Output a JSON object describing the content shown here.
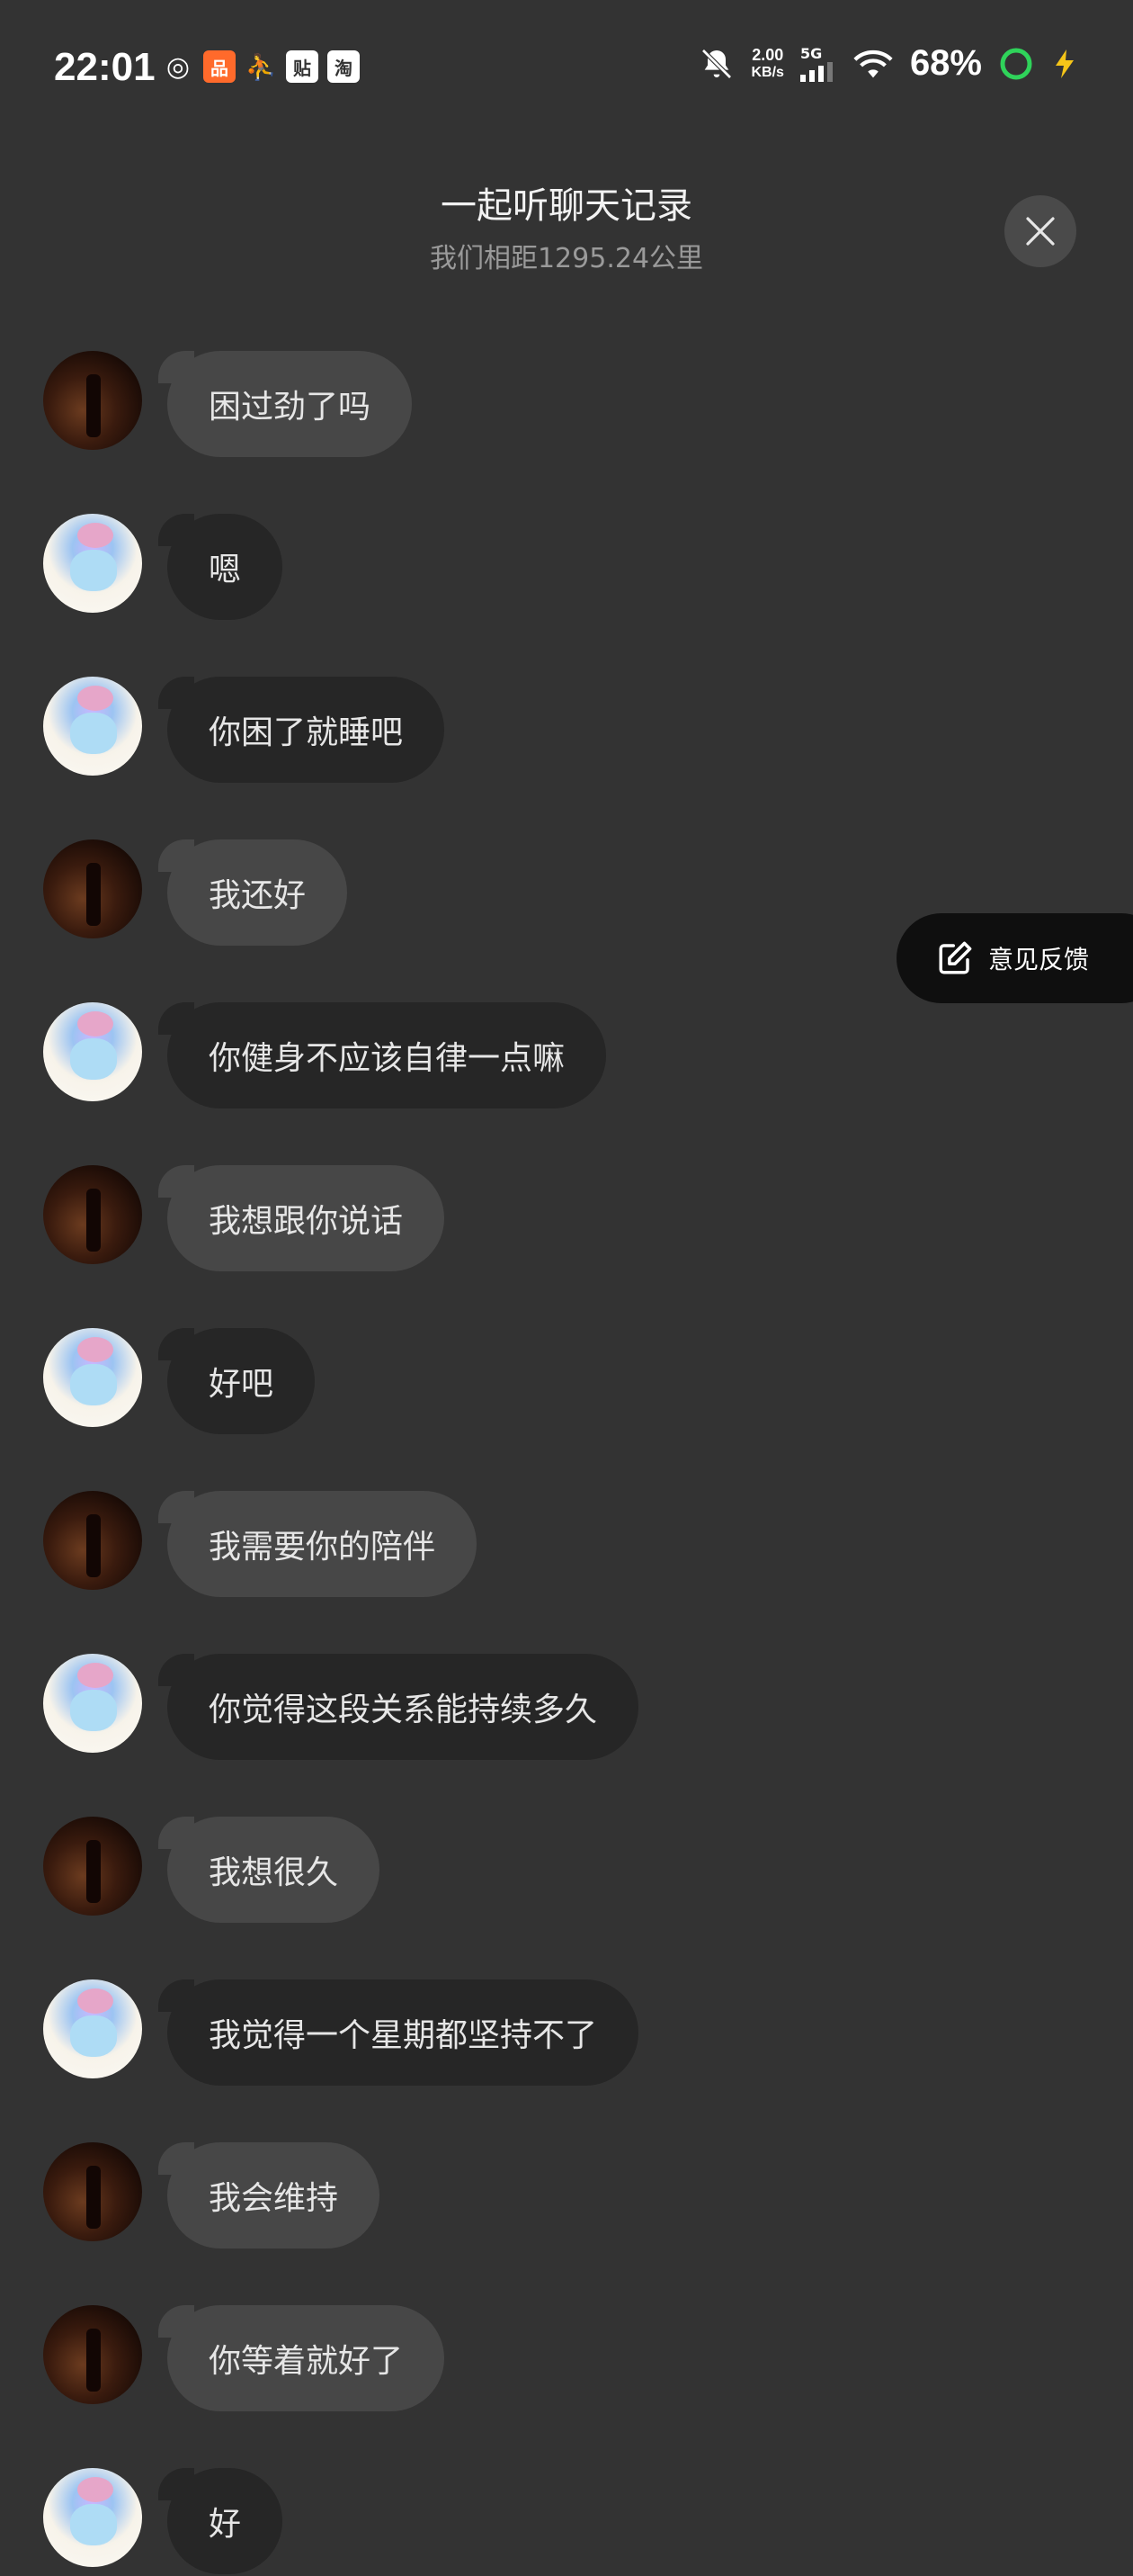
{
  "status_bar": {
    "time": "22:01",
    "apps": [
      {
        "icon": "netease-music-icon",
        "glyph": "◎",
        "color": "#ffffff"
      },
      {
        "icon": "app-orange-icon",
        "glyph": "品",
        "color": "#ff6a2b"
      },
      {
        "icon": "keep-icon",
        "glyph": "✕",
        "color": "#ffffff"
      },
      {
        "icon": "tieba-icon",
        "glyph": "贴",
        "color": "#ffffff"
      },
      {
        "icon": "taobao-icon",
        "glyph": "淘",
        "color": "#ffffff"
      }
    ],
    "speed_value": "2.00",
    "speed_unit": "KB/s",
    "network": "5G",
    "battery": "68%"
  },
  "header": {
    "title": "一起听聊天记录",
    "subtitle": "我们相距1295.24公里"
  },
  "messages": [
    {
      "avatar": "dark",
      "bubble": "light",
      "text": "困过劲了吗"
    },
    {
      "avatar": "light",
      "bubble": "dark",
      "text": "嗯"
    },
    {
      "avatar": "light",
      "bubble": "dark",
      "text": "你困了就睡吧"
    },
    {
      "avatar": "dark",
      "bubble": "light",
      "text": "我还好"
    },
    {
      "avatar": "light",
      "bubble": "dark",
      "text": "你健身不应该自律一点嘛"
    },
    {
      "avatar": "dark",
      "bubble": "light",
      "text": "我想跟你说话"
    },
    {
      "avatar": "light",
      "bubble": "dark",
      "text": "好吧"
    },
    {
      "avatar": "dark",
      "bubble": "light",
      "text": "我需要你的陪伴"
    },
    {
      "avatar": "light",
      "bubble": "dark",
      "text": "你觉得这段关系能持续多久"
    },
    {
      "avatar": "dark",
      "bubble": "light",
      "text": "我想很久"
    },
    {
      "avatar": "light",
      "bubble": "dark",
      "text": "我觉得一个星期都坚持不了"
    },
    {
      "avatar": "dark",
      "bubble": "light",
      "text": "我会维持"
    },
    {
      "avatar": "dark",
      "bubble": "light",
      "text": "你等着就好了"
    },
    {
      "avatar": "light",
      "bubble": "dark",
      "text": "好"
    }
  ],
  "feedback": {
    "label": "意见反馈",
    "icon": "edit-icon"
  },
  "colors": {
    "background": "#333333",
    "bubble_light": "#474747",
    "bubble_dark": "#262626"
  }
}
